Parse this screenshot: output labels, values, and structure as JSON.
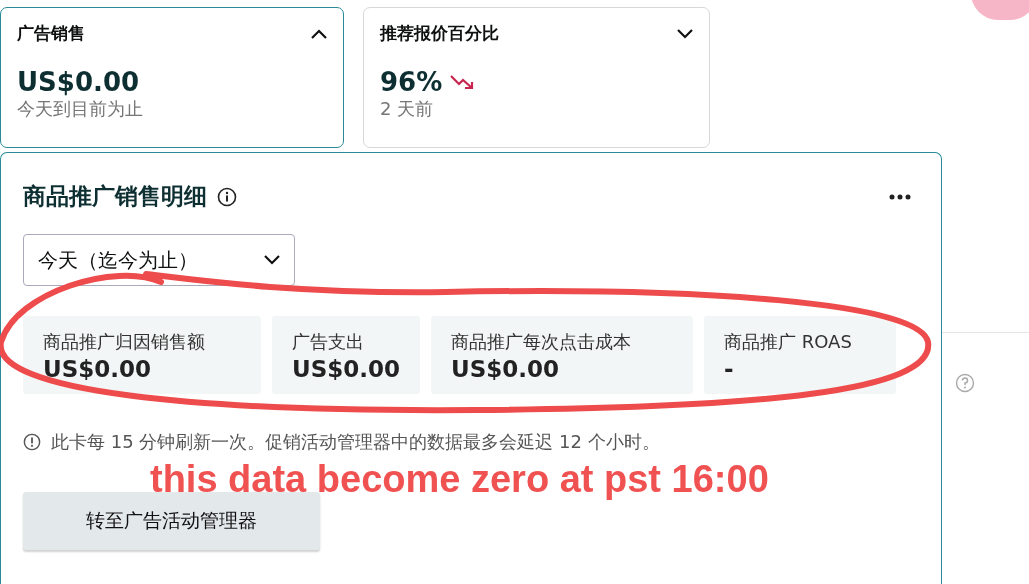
{
  "summary_cards": [
    {
      "title": "广告销售",
      "value": "US$0.00",
      "subtitle": "今天到目前为止",
      "expanded": true,
      "trending_down": false
    },
    {
      "title": "推荐报价百分比",
      "value": "96%",
      "subtitle": "2 天前",
      "expanded": false,
      "trending_down": true
    }
  ],
  "detail_card": {
    "title": "商品推广销售明细",
    "range_select": {
      "value": "今天（迄今为止）"
    },
    "metrics": [
      {
        "label": "商品推广归因销售额",
        "value": "US$0.00"
      },
      {
        "label": "广告支出",
        "value": "US$0.00"
      },
      {
        "label": "商品推广每次点击成本",
        "value": "US$0.00"
      },
      {
        "label": "商品推广 ROAS",
        "value": "-"
      }
    ],
    "note": "此卡每 15 分钟刷新一次。促销活动管理器中的数据最多会延迟 12 个小时。",
    "button": "转至广告活动管理器"
  },
  "annotation": {
    "text": "this data become zero at pst 16:00"
  }
}
